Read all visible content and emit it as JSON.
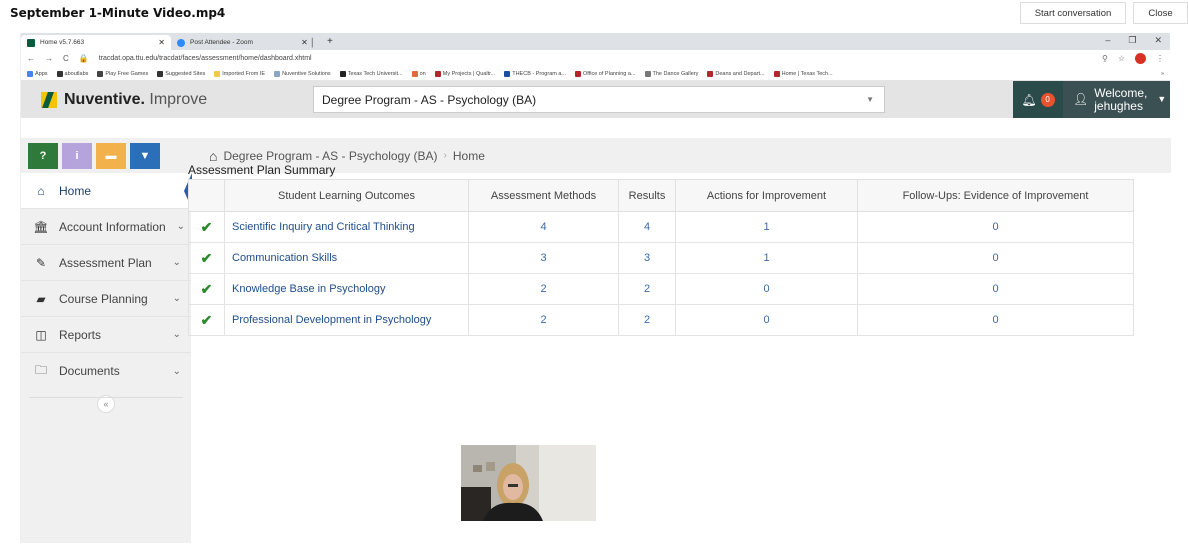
{
  "video": {
    "title": "September 1-Minute Video.mp4",
    "start_label": "Start conversation",
    "close_label": "Close"
  },
  "browser": {
    "tabs": [
      {
        "label": "Home v5.7.663",
        "fav_color": "#0a5b3e"
      },
      {
        "label": "Post Attendee - Zoom",
        "fav_color": "#2d8cff"
      }
    ],
    "url": "tracdat.opa.ttu.edu/tracdat/faces/assessment/home/dashboard.xhtml",
    "bookmarks": [
      {
        "label": "Apps",
        "color": "#4285f4"
      },
      {
        "label": "aboutlabs",
        "color": "#333333"
      },
      {
        "label": "Play Free Games",
        "color": "#444444"
      },
      {
        "label": "Suggested Sites",
        "color": "#333333"
      },
      {
        "label": "Imported From IE",
        "color": "#f2c94c"
      },
      {
        "label": "Nuventive Solutions",
        "color": "#8aa6c8"
      },
      {
        "label": "Texas Tech Universit...",
        "color": "#222222"
      },
      {
        "label": "on",
        "color": "#e06a3b"
      },
      {
        "label": "My Projects | Qualtr...",
        "color": "#b2282a"
      },
      {
        "label": "THECB - Program a...",
        "color": "#1e4f9c"
      },
      {
        "label": "Office of Planning a...",
        "color": "#b2282a"
      },
      {
        "label": "The Dance Gallery",
        "color": "#777777"
      },
      {
        "label": "Deans and Depart...",
        "color": "#b2282a"
      },
      {
        "label": "Home | Texas Tech...",
        "color": "#b2282a"
      }
    ]
  },
  "app": {
    "brand": "Nuventive.",
    "brand_sub": " Improve",
    "program": "Degree Program - AS - Psychology (BA)",
    "notifications": "0",
    "welcome_line1": "Welcome,",
    "welcome_line2": "jehughes"
  },
  "quick_buttons": [
    {
      "label": "?",
      "color": "#2f7a3a"
    },
    {
      "label": "i",
      "color": "#b5a4dc"
    },
    {
      "label": "▬",
      "color": "#f2b14a"
    },
    {
      "label": "▼",
      "color": "#2a6fb8"
    }
  ],
  "nav": [
    {
      "label": "Home",
      "icon": "home-icon"
    },
    {
      "label": "Account Information",
      "icon": "bank-icon"
    },
    {
      "label": "Assessment Plan",
      "icon": "pencil-icon"
    },
    {
      "label": "Course Planning",
      "icon": "book-icon"
    },
    {
      "label": "Reports",
      "icon": "columns-icon"
    },
    {
      "label": "Documents",
      "icon": "folder-icon"
    }
  ],
  "breadcrumb": {
    "program": "Degree Program - AS - Psychology (BA)",
    "current": "Home"
  },
  "summary": {
    "title": "Assessment Plan Summary",
    "headers": [
      "Student Learning Outcomes",
      "Assessment Methods",
      "Results",
      "Actions for Improvement",
      "Follow-Ups: Evidence of Improvement"
    ],
    "rows": [
      {
        "outcome": "Scientific Inquiry and Critical Thinking",
        "methods": "4",
        "results": "4",
        "actions": "1",
        "followups": "0"
      },
      {
        "outcome": "Communication Skills",
        "methods": "3",
        "results": "3",
        "actions": "1",
        "followups": "0"
      },
      {
        "outcome": "Knowledge Base in Psychology",
        "methods": "2",
        "results": "2",
        "actions": "0",
        "followups": "0"
      },
      {
        "outcome": "Professional Development in Psychology",
        "methods": "2",
        "results": "2",
        "actions": "0",
        "followups": "0"
      }
    ]
  }
}
